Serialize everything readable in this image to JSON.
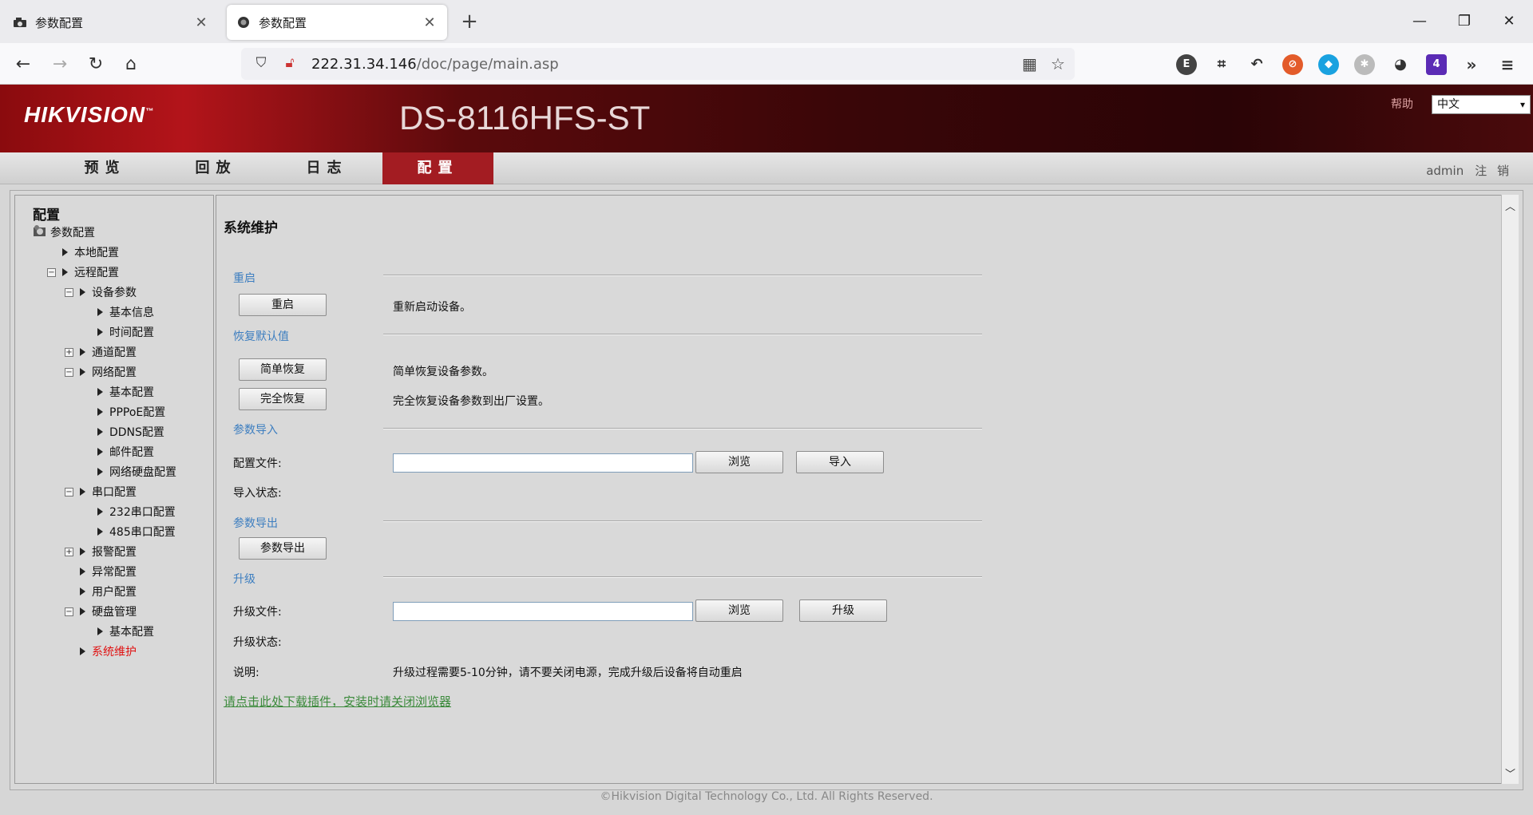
{
  "browser": {
    "tabs": [
      {
        "title": "参数配置",
        "active": false
      },
      {
        "title": "参数配置",
        "active": true
      }
    ],
    "url_host": "222.31.34.146",
    "url_path": "/doc/page/main.asp",
    "extension_badge": "4"
  },
  "header": {
    "logo": "HIKVISION",
    "logo_tm": "™",
    "model": "DS-8116HFS-ST",
    "help": "帮助",
    "language": "中文"
  },
  "menu": {
    "items": [
      "预览",
      "回放",
      "日志",
      "配置"
    ],
    "active": "配置",
    "user": "admin",
    "logout": "注 销"
  },
  "sidebar": {
    "title": "配置",
    "tree": [
      {
        "label": "参数配置",
        "level": 0,
        "type": "root"
      },
      {
        "label": "本地配置",
        "level": 1,
        "type": "leaf"
      },
      {
        "label": "远程配置",
        "level": 1,
        "type": "expanded"
      },
      {
        "label": "设备参数",
        "level": 2,
        "type": "expanded"
      },
      {
        "label": "基本信息",
        "level": 3,
        "type": "leaf"
      },
      {
        "label": "时间配置",
        "level": 3,
        "type": "leaf"
      },
      {
        "label": "通道配置",
        "level": 2,
        "type": "collapsed"
      },
      {
        "label": "网络配置",
        "level": 2,
        "type": "expanded"
      },
      {
        "label": "基本配置",
        "level": 3,
        "type": "leaf"
      },
      {
        "label": "PPPoE配置",
        "level": 3,
        "type": "leaf"
      },
      {
        "label": "DDNS配置",
        "level": 3,
        "type": "leaf"
      },
      {
        "label": "邮件配置",
        "level": 3,
        "type": "leaf"
      },
      {
        "label": "网络硬盘配置",
        "level": 3,
        "type": "leaf"
      },
      {
        "label": "串口配置",
        "level": 2,
        "type": "expanded"
      },
      {
        "label": "232串口配置",
        "level": 3,
        "type": "leaf"
      },
      {
        "label": "485串口配置",
        "level": 3,
        "type": "leaf"
      },
      {
        "label": "报警配置",
        "level": 2,
        "type": "collapsed"
      },
      {
        "label": "异常配置",
        "level": 2,
        "type": "leaf"
      },
      {
        "label": "用户配置",
        "level": 2,
        "type": "leaf"
      },
      {
        "label": "硬盘管理",
        "level": 2,
        "type": "expanded"
      },
      {
        "label": "基本配置",
        "level": 3,
        "type": "leaf"
      },
      {
        "label": "系统维护",
        "level": 2,
        "type": "leaf",
        "selected": true
      }
    ]
  },
  "main": {
    "title": "系统维护",
    "reboot": {
      "section": "重启",
      "button": "重启",
      "desc": "重新启动设备。"
    },
    "restore": {
      "section": "恢复默认值",
      "simple_button": "简单恢复",
      "simple_desc": "简单恢复设备参数。",
      "full_button": "完全恢复",
      "full_desc": "完全恢复设备参数到出厂设置。"
    },
    "import": {
      "section": "参数导入",
      "file_label": "配置文件:",
      "file_value": "",
      "browse": "浏览",
      "import_button": "导入",
      "status_label": "导入状态:"
    },
    "export": {
      "section": "参数导出",
      "button": "参数导出"
    },
    "upgrade": {
      "section": "升级",
      "file_label": "升级文件:",
      "file_value": "",
      "browse": "浏览",
      "upgrade_button": "升级",
      "status_label": "升级状态:",
      "note_label": "说明:",
      "note": "升级过程需要5-10分钟，请不要关闭电源，完成升级后设备将自动重启"
    },
    "plugin_link": "请点击此处下载插件，安装时请关闭浏览器"
  },
  "footer": "©Hikvision Digital Technology Co., Ltd. All Rights Reserved.",
  "colors": {
    "brand_red": "#a31c22",
    "section_blue": "#3d7ec0",
    "link_green": "#3b8a3b",
    "selected_red": "#e01010"
  }
}
